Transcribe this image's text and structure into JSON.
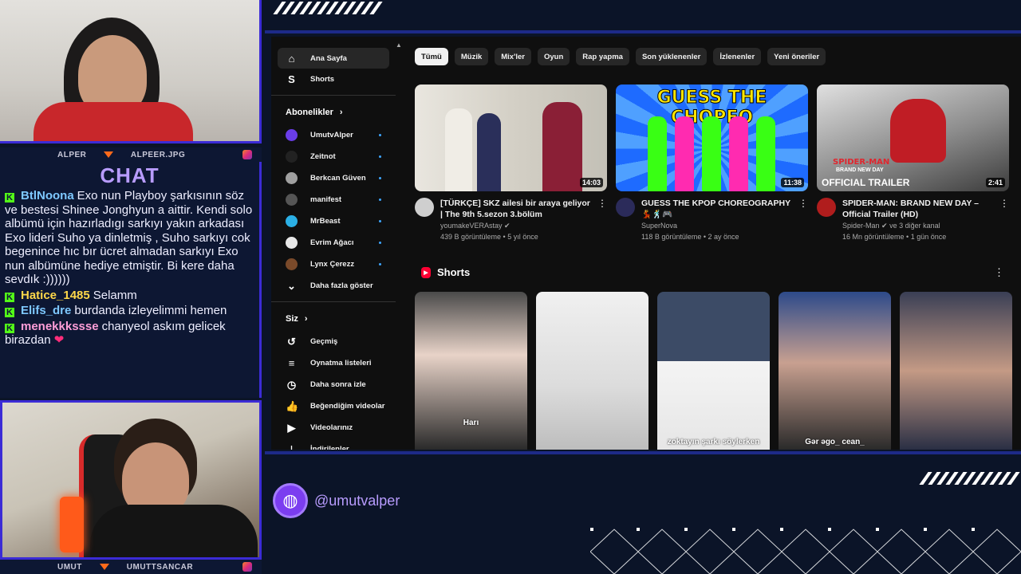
{
  "streamer_top": {
    "left_label": "ALPER",
    "right_label": "ALPEER.JPG"
  },
  "streamer_bottom": {
    "left_label": "UMUT",
    "right_label": "UMUTTSANCAR"
  },
  "chat": {
    "title": "CHAT",
    "messages": [
      {
        "user": "BtlNoona",
        "color": "#7ec8ff",
        "text": "Exo nun Playboy şarkısının söz ve bestesi Shinee Jonghyun a aittir. Kendi solo albümü için hazırladıgı sarkıyı yakın arkadası Exo lideri Suho ya dinletmiş , Suho sarkıyı cok begenince hıc bır ücret almadan sarkıyı Exo nun albümüne hediye etmiştir. Bi kere daha sevdık :))))))"
      },
      {
        "user": "Hatice_1485",
        "color": "#ffd84a",
        "text": "Selamm"
      },
      {
        "user": "Elifs_dre",
        "color": "#7ec8ff",
        "text": "burdanda izleyelimmi hemen"
      },
      {
        "user": "menekkkssse",
        "color": "#ff9ed8",
        "text": "chanyeol askım gelicek birazdan"
      }
    ]
  },
  "handle": {
    "text": "@umutvalper",
    "icon": "globe-icon"
  },
  "youtube": {
    "sidebar": {
      "main": [
        {
          "label": "Ana Sayfa",
          "icon": "home-icon",
          "glyph": "⌂",
          "active": true
        },
        {
          "label": "Shorts",
          "icon": "shorts-icon",
          "glyph": "S",
          "active": false
        }
      ],
      "subscriptions_header": "Abonelikler",
      "subscriptions": [
        {
          "label": "UmutvAlper",
          "color": "#6a3de8"
        },
        {
          "label": "Zeitnot",
          "color": "#222222"
        },
        {
          "label": "Berkcan Güven",
          "color": "#a0a0a0"
        },
        {
          "label": "manifest",
          "color": "#555555"
        },
        {
          "label": "MrBeast",
          "color": "#2bb0e6"
        },
        {
          "label": "Evrim Ağacı",
          "color": "#e8e8e8"
        },
        {
          "label": "Lynx Çerezz",
          "color": "#7a4a2a"
        }
      ],
      "show_more": "Daha fazla göster",
      "you_header": "Siz",
      "you_items": [
        {
          "label": "Geçmiş",
          "icon": "history-icon",
          "glyph": "↺"
        },
        {
          "label": "Oynatma listeleri",
          "icon": "playlists-icon",
          "glyph": "≡"
        },
        {
          "label": "Daha sonra izle",
          "icon": "watch-later-icon",
          "glyph": "◷"
        },
        {
          "label": "Beğendiğim videolar",
          "icon": "like-icon",
          "glyph": "👍"
        },
        {
          "label": "Videolarınız",
          "icon": "your-videos-icon",
          "glyph": "▶"
        },
        {
          "label": "İndirilenler",
          "icon": "downloads-icon",
          "glyph": "⤓"
        }
      ]
    },
    "chips": [
      "Tümü",
      "Müzik",
      "Mix'ler",
      "Oyun",
      "Rap yapma",
      "Son yüklenenler",
      "İzlenenler",
      "Yeni öneriler"
    ],
    "videos": [
      {
        "title": "[TÜRKÇE] SKZ ailesi bir araya geliyor | The 9th 5.sezon 3.bölüm",
        "channel": "youmakeVERAstay ✔",
        "meta": "439 B görüntüleme • 5 yıl önce",
        "duration": "14:03",
        "thumb_color": "#d8d4cc",
        "avatar_color": "#cfcfcf"
      },
      {
        "title": "GUESS THE KPOP CHOREOGRAPHY💃🕺🎮",
        "channel": "SuperNova",
        "meta": "118 B görüntüleme • 2 ay önce",
        "duration": "11:38",
        "thumb_color": "#1e6bff",
        "avatar_color": "#2b2b5a"
      },
      {
        "title": "SPIDER-MAN: BRAND NEW DAY – Official Trailer (HD)",
        "channel": "Spider-Man ✔ ve 3 diğer kanal",
        "meta": "16 Mn görüntüleme • 1 gün önce",
        "duration": "2:41",
        "thumb_color": "#9a9a9a",
        "avatar_color": "#b01d1d"
      }
    ],
    "thumb_texts": {
      "guess": "GUESS THE CHOPEO",
      "spider_title": "SPIDER-MAN",
      "spider_sub": "BRAND NEW DAY",
      "trailer": "OFFICIAL TRAILER"
    },
    "shorts_title": "Shorts",
    "shorts": [
      {
        "caption": "Harı",
        "color": "#3a3a3a"
      },
      {
        "caption": "",
        "color": "#e2e2e2"
      },
      {
        "caption": "zoktayın şarkı söylerken",
        "color": "#d9d9d9"
      },
      {
        "caption": "Gər əgo_ cean_",
        "color": "#5a6f8a"
      },
      {
        "caption": "",
        "color": "#3a3f55"
      }
    ]
  }
}
